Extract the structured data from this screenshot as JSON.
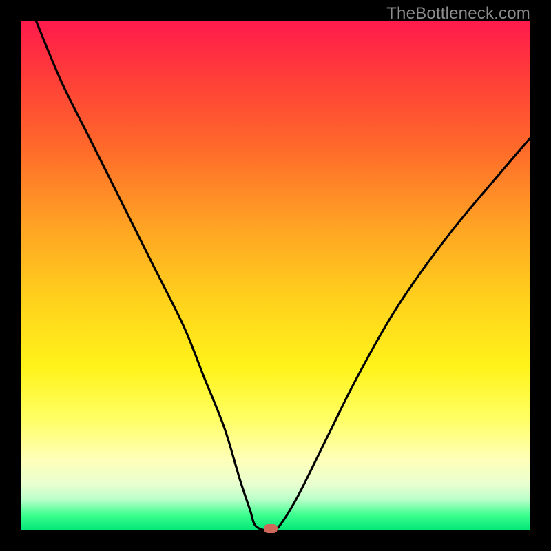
{
  "watermark": "TheBottleneck.com",
  "colors": {
    "frame": "#000000",
    "curve": "#000000",
    "dot": "#cf6a5a",
    "gradient_top": "#ff1a4d",
    "gradient_bottom": "#00e676"
  },
  "chart_data": {
    "type": "line",
    "title": "",
    "xlabel": "",
    "ylabel": "",
    "xlim": [
      0,
      100
    ],
    "ylim": [
      0,
      100
    ],
    "grid": false,
    "legend": false,
    "series": [
      {
        "name": "bottleneck-curve",
        "x": [
          3,
          8,
          14,
          20,
          26,
          32,
          36,
          40,
          43,
          45,
          46,
          48,
          50,
          54,
          60,
          66,
          74,
          84,
          94,
          100
        ],
        "values": [
          100,
          88,
          76,
          64,
          52,
          40,
          30,
          20,
          10,
          4,
          1,
          0,
          0,
          6,
          18,
          30,
          44,
          58,
          70,
          77
        ]
      }
    ],
    "annotations": [
      {
        "name": "optimal-point",
        "x": 49,
        "y": 0
      }
    ]
  }
}
